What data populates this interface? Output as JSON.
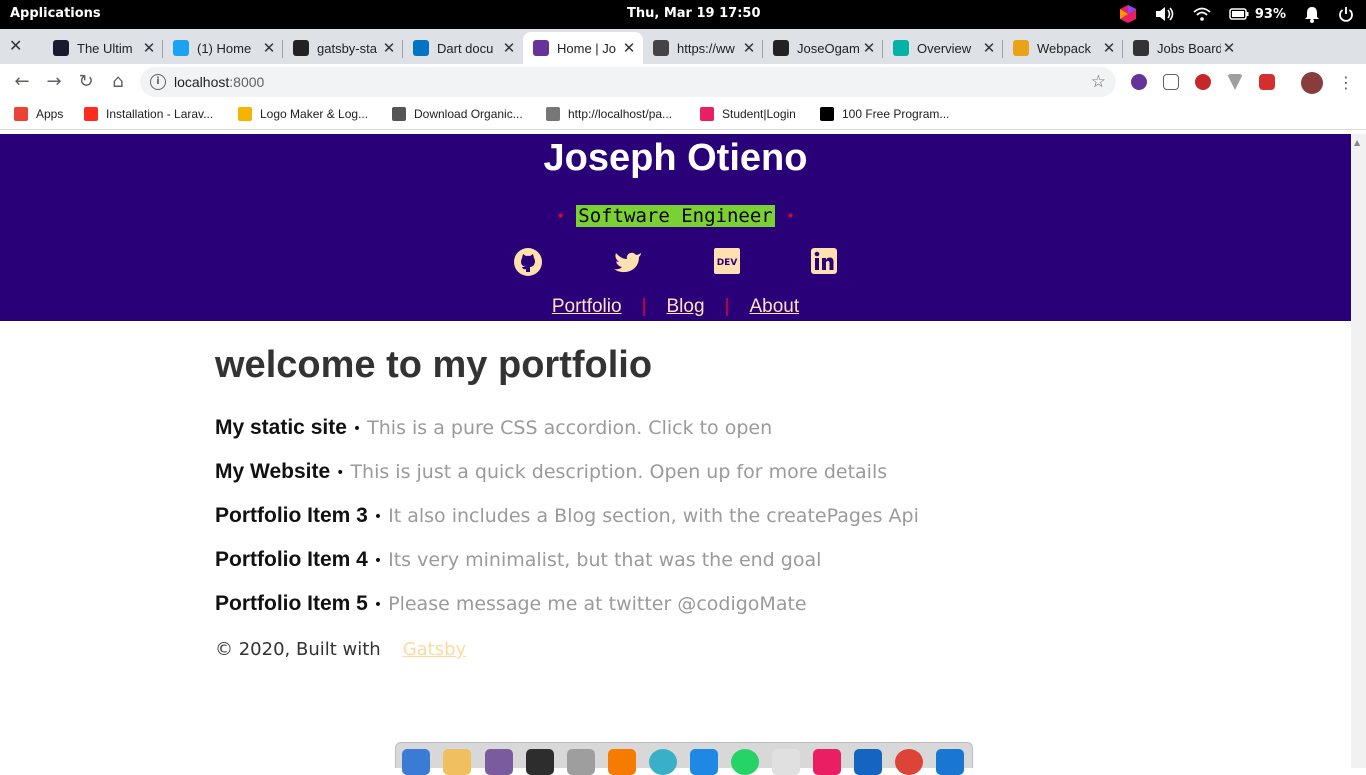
{
  "system_bar": {
    "apps_label": "Applications",
    "datetime": "Thu, Mar 19    17:50",
    "battery": "93%"
  },
  "tabs": [
    {
      "title": "The Ultim",
      "favicon": "angular-icon",
      "color": "#1a1a2e"
    },
    {
      "title": "(1) Home",
      "favicon": "twitter-icon",
      "color": "#1da1f2"
    },
    {
      "title": "gatsby-sta",
      "favicon": "github-icon",
      "color": "#222222"
    },
    {
      "title": "Dart docu",
      "favicon": "dart-icon",
      "color": "#0175c2"
    },
    {
      "title": "Home | Jo",
      "favicon": "gatsby-icon",
      "color": "#663399",
      "active": true
    },
    {
      "title": "https://ww",
      "favicon": "person-icon",
      "color": "#444444"
    },
    {
      "title": "JoseOgam",
      "favicon": "github-icon",
      "color": "#222222"
    },
    {
      "title": "Overview",
      "favicon": "diamond-icon",
      "color": "#00b3a4"
    },
    {
      "title": "Webpack",
      "favicon": "gm-icon",
      "color": "#e8a317"
    },
    {
      "title": "Jobs Board",
      "favicon": "jobs-icon",
      "color": "#333333"
    }
  ],
  "address_bar": {
    "host": "localhost",
    "port": ":8000"
  },
  "bookmarks": [
    {
      "label": "Apps",
      "icon": "apps-grid-icon",
      "color": "#ea4335"
    },
    {
      "label": "Installation - Larav...",
      "icon": "laravel-icon",
      "color": "#ff2d20"
    },
    {
      "label": "Logo Maker & Log...",
      "icon": "logo-maker-icon",
      "color": "#f5b400"
    },
    {
      "label": "Download Organic...",
      "icon": "w3-icon",
      "color": "#555555"
    },
    {
      "label": "http://localhost/pa...",
      "icon": "globe-icon",
      "color": "#777777"
    },
    {
      "label": "Student|Login",
      "icon": "student-icon",
      "color": "#e91e63"
    },
    {
      "label": "100 Free Program...",
      "icon": "dev-icon",
      "color": "#000000"
    }
  ],
  "site": {
    "title": "Joseph Otieno",
    "tagline": "Software Engineer",
    "social": [
      "github-icon",
      "twitter-icon",
      "dev-icon",
      "linkedin-icon"
    ],
    "menu": [
      "Portfolio",
      "Blog",
      "About"
    ],
    "heading": "welcome to my portfolio",
    "items": [
      {
        "title": "My static site",
        "desc": "This is a pure CSS accordion. Click to open"
      },
      {
        "title": "My Website",
        "desc": "This is just a quick description. Open up for more details"
      },
      {
        "title": "Portfolio Item 3",
        "desc": "It also includes a Blog section, with the createPages Api"
      },
      {
        "title": "Portfolio Item 4",
        "desc": "Its very minimalist, but that was the end goal"
      },
      {
        "title": "Portfolio Item 5",
        "desc": "Please message me at twitter @codigoMate"
      }
    ],
    "footer_text": "© 2020, Built with",
    "footer_link": "Gatsby"
  },
  "colors": {
    "header_bg": "#2a0078",
    "tagline_highlight": "#7bd134",
    "accent_red": "#e0003c"
  }
}
